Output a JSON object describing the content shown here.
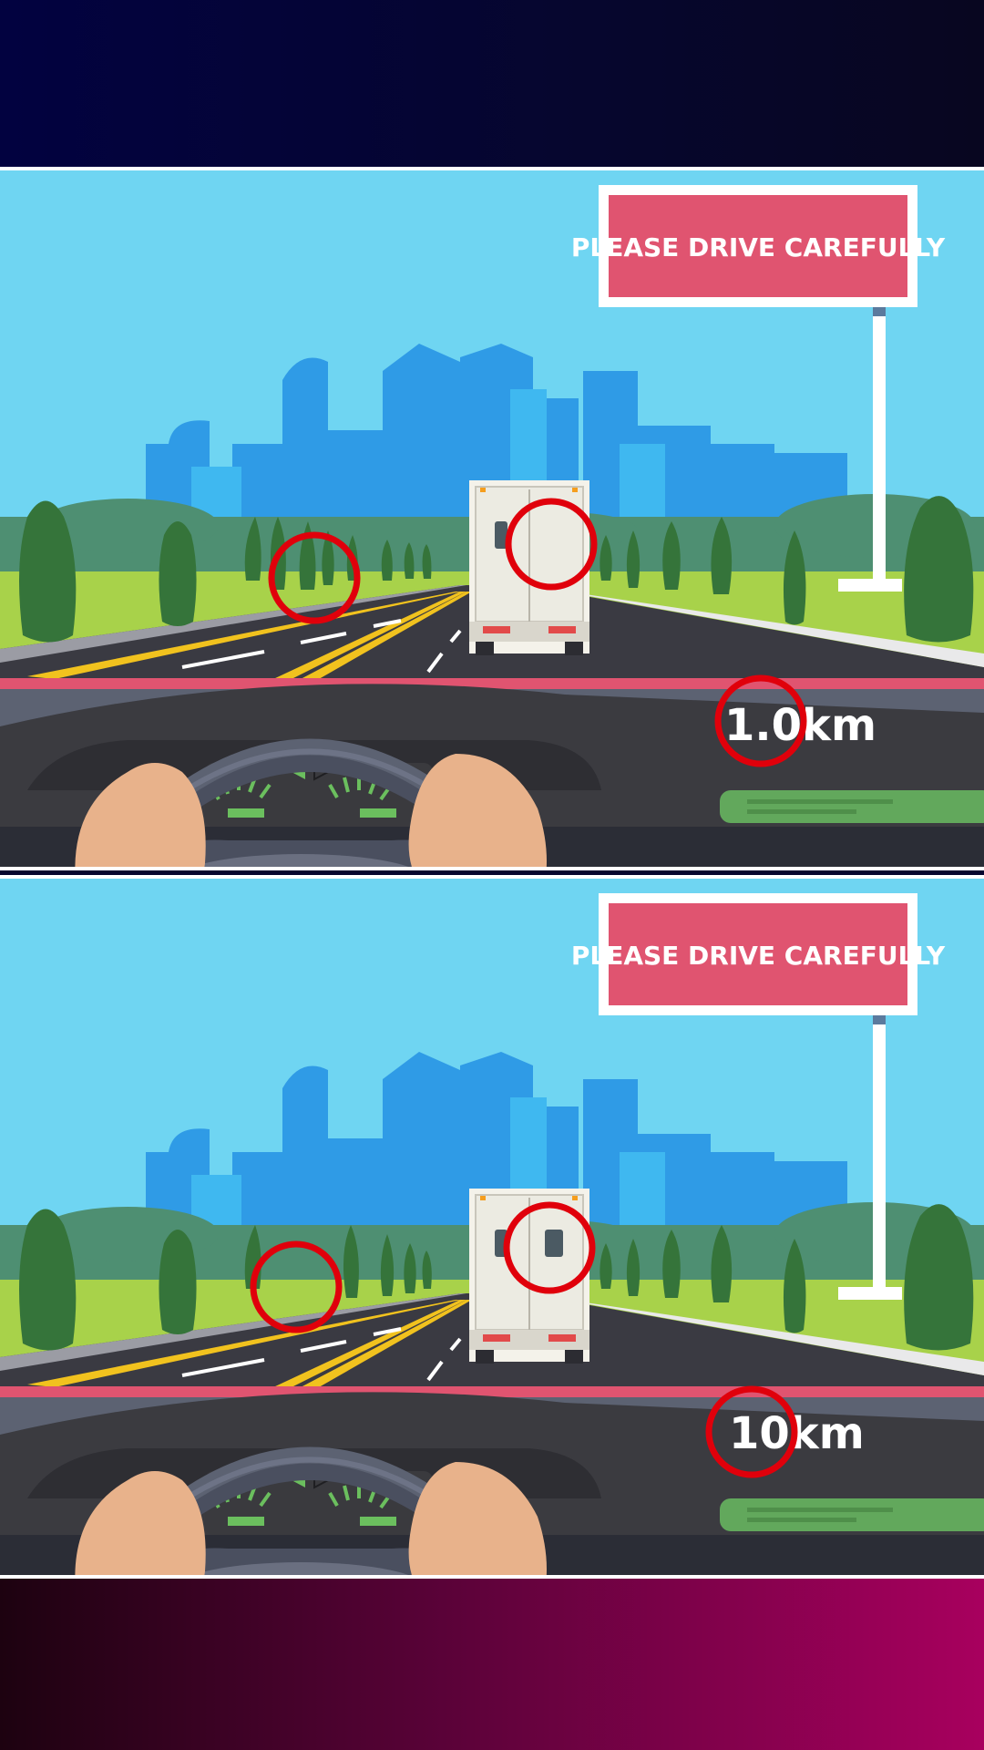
{
  "panels": {
    "original": {
      "sign_text": "PLEASE DRIVE CAREFULLY",
      "distance_text": "1.0km"
    },
    "modified": {
      "sign_text": "PLEASE DRIVE CAREFULLY",
      "distance_text": "10km"
    }
  },
  "colors": {
    "sky": "#6fd5f2",
    "sign": "#e05470",
    "circle_marker": "#e0000b",
    "dashboard": "#5c6272",
    "left_sleeve": "#347392",
    "right_sleeve_original": "#8e3a6a"
  }
}
